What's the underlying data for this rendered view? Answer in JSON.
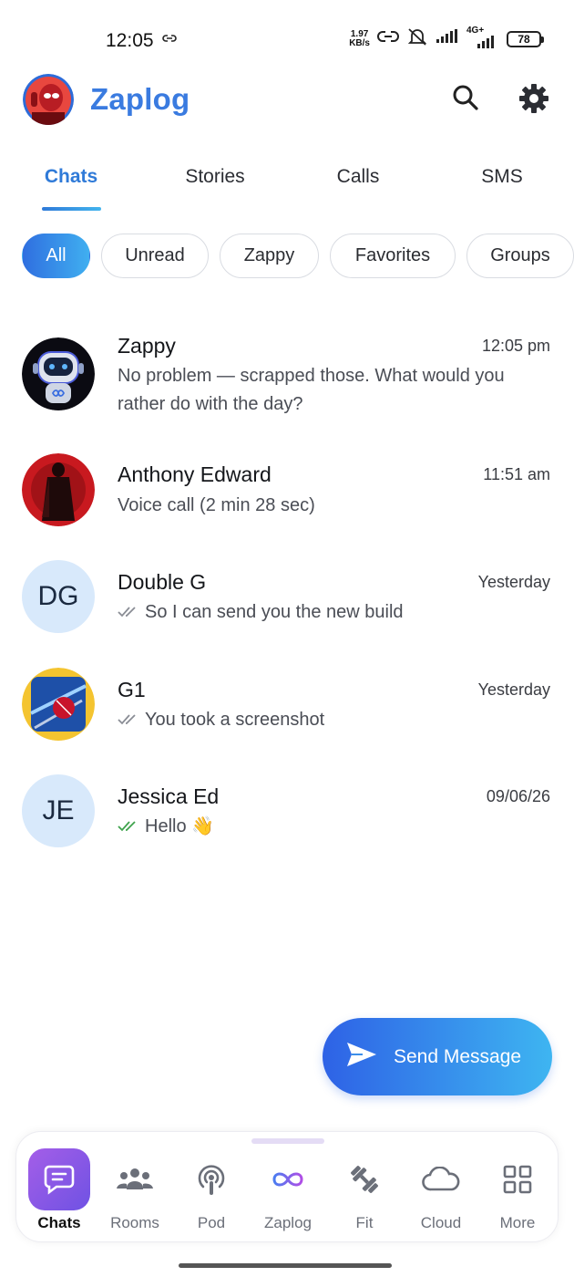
{
  "status_bar": {
    "time": "12:05",
    "speed_value": "1.97",
    "speed_unit": "KB/s",
    "network": "4G+",
    "battery": "78"
  },
  "header": {
    "title": "Zaplog",
    "search_icon": "search-icon",
    "settings_icon": "gear-icon"
  },
  "tabs": [
    {
      "label": "Chats",
      "active": true
    },
    {
      "label": "Stories",
      "active": false
    },
    {
      "label": "Calls",
      "active": false
    },
    {
      "label": "SMS",
      "active": false
    }
  ],
  "filters": [
    {
      "label": "All",
      "active": true
    },
    {
      "label": "Unread",
      "active": false
    },
    {
      "label": "Zappy",
      "active": false
    },
    {
      "label": "Favorites",
      "active": false
    },
    {
      "label": "Groups",
      "active": false
    }
  ],
  "chats": [
    {
      "name": "Zappy",
      "time": "12:05 pm",
      "message": "No problem — scrapped those. What would you rather do with the day?",
      "avatar": "robot-avatar"
    },
    {
      "name": "Anthony Edward",
      "time": "11:51 am",
      "message": "Voice call (2 min 28 sec)",
      "avatar": "hero-avatar"
    },
    {
      "name": "Double G",
      "time": "Yesterday",
      "message": "So I can send you the new build",
      "initials": "DG",
      "tick": "read-gray"
    },
    {
      "name": "G1",
      "time": "Yesterday",
      "message": "You took a screenshot",
      "avatar": "cricket-avatar",
      "tick": "read-gray"
    },
    {
      "name": "Jessica Ed",
      "time": "09/06/26",
      "message": "Hello 👋",
      "initials": "JE",
      "tick": "read-green"
    }
  ],
  "fab": {
    "label": "Send Message"
  },
  "bottom_nav": [
    {
      "label": "Chats",
      "icon": "chat-icon",
      "active": true
    },
    {
      "label": "Rooms",
      "icon": "people-icon",
      "active": false
    },
    {
      "label": "Pod",
      "icon": "podcast-icon",
      "active": false
    },
    {
      "label": "Zaplog",
      "icon": "infinity-icon",
      "active": false
    },
    {
      "label": "Fit",
      "icon": "dumbbell-icon",
      "active": false
    },
    {
      "label": "Cloud",
      "icon": "cloud-icon",
      "active": false
    },
    {
      "label": "More",
      "icon": "grid-icon",
      "active": false
    }
  ],
  "colors": {
    "accent": "#2f7ad8",
    "tick_green": "#3fa34d"
  }
}
